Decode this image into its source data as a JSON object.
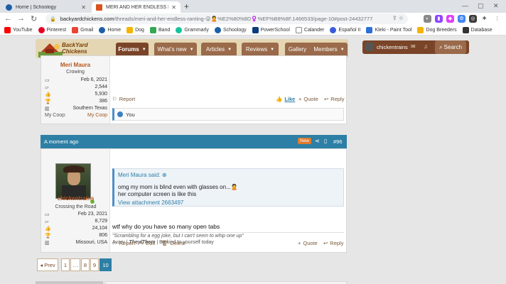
{
  "browser": {
    "tabs": [
      {
        "title": "Home | Schoology",
        "active": false
      },
      {
        "title": "MERI AND HER ENDLESS RANTI",
        "active": true
      }
    ],
    "url_host": "backyardchickens.com",
    "url_path": "/threads/meri-and-her-endless-ranting-😜🙎%E2%80%8D♀️%EF%B8%8F.1466533/page-10#post-24432777",
    "bookmarks": [
      "YouTube",
      "Pinterest",
      "Gmail",
      "Home",
      "Dog",
      "Band",
      "Grammarly",
      "Schoology",
      "PowerSchool",
      "Calander",
      "Español II",
      "Kleki - Paint Tool",
      "Dog Breeders",
      "Database"
    ]
  },
  "site": {
    "logo": "BackYard Chickens",
    "nav": [
      "Forums",
      "What's new",
      "Articles",
      "Reviews",
      "Gallery",
      "Members"
    ],
    "username": "chickentrains",
    "search_label": "Search"
  },
  "post1": {
    "username": "Meri Maura",
    "user_title": "Crowing",
    "stats": {
      "joined": "Feb 6, 2021",
      "messages": "2,544",
      "reactions": "5,930",
      "points": "386",
      "location": "Southern Texas",
      "coop_label": "My Coop:",
      "coop_value": "My Coop"
    },
    "actions": {
      "report": "Report",
      "like": "Like",
      "quote": "Quote",
      "reply": "Reply"
    },
    "likes_text": "You"
  },
  "post2": {
    "time": "A moment ago",
    "new_badge": "New",
    "post_number": "#96",
    "username": "chickentrains",
    "user_title": "Crossing the Road",
    "stats": {
      "joined": "Feb 23, 2021",
      "messages": "8,729",
      "reactions": "24,104",
      "points": "806",
      "location": "Missouri, USA"
    },
    "quote": {
      "author": "Meri Maura said:",
      "line1": "omg my mom is blind even with glasses on...🙎",
      "line2": "her computer screen is like this",
      "link": "View attachment 2663497"
    },
    "message": "wtf why do you have so many open tabs",
    "signature": {
      "line1": "\"Scrambling for a egg joke, but I can't seem to whip one up\"",
      "line2_prefix": "Avary | ",
      "line2_pronouns": "They/Them",
      "line2_suffix": " | Be kind to yourself today"
    },
    "actions": {
      "report": "Report",
      "edit": "Edit",
      "delete": "Delete",
      "quote": "Quote",
      "reply": "Reply"
    }
  },
  "pagination": {
    "prev": "◂ Prev",
    "pages": [
      "1",
      "…",
      "8",
      "9",
      "10"
    ],
    "current": "10"
  }
}
